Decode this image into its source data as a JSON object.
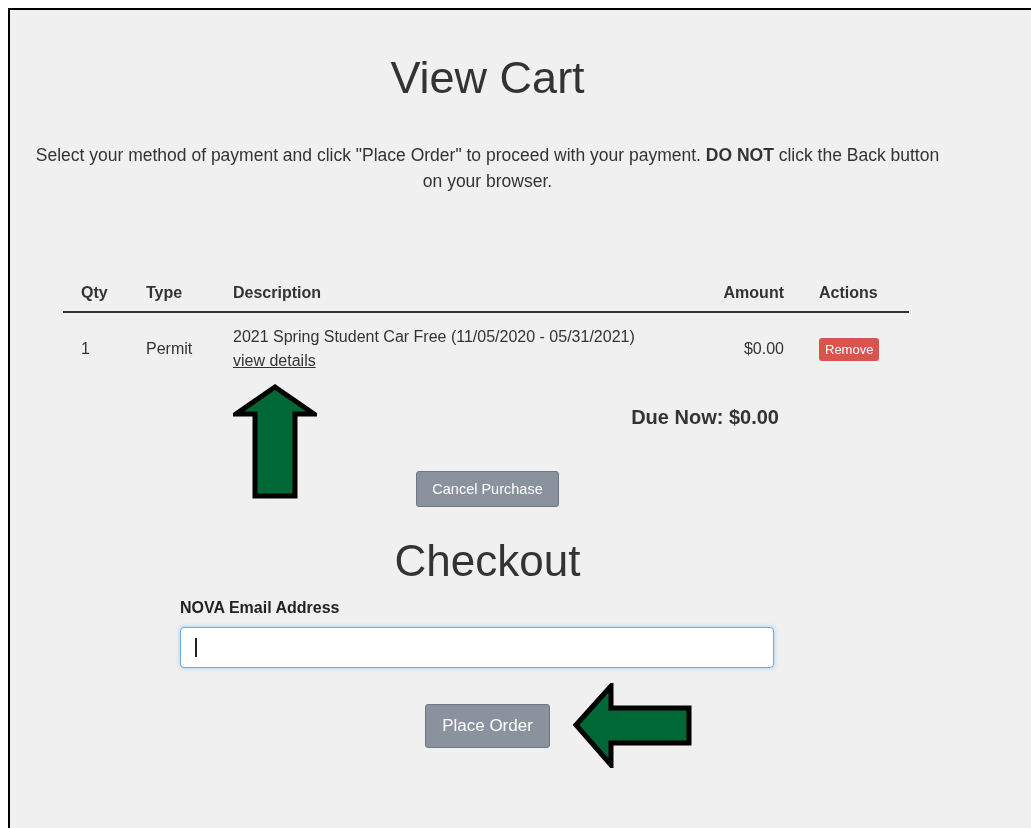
{
  "view_cart": {
    "title": "View Cart",
    "instructions": "Select your method of payment and click \"Place Order\" to proceed with your payment. **DO NOT** click the Back button on your browser.",
    "table": {
      "columns": [
        "Qty",
        "Type",
        "Description",
        "Amount",
        "Actions"
      ],
      "rows": [
        {
          "qty": "1",
          "type": "Permit",
          "description": "2021 Spring Student Car Free (11/05/2020 - 05/31/2021)",
          "details_link": "view details",
          "amount": "$0.00",
          "action": "Remove"
        }
      ]
    },
    "due_now": "Due Now: $0.00",
    "cancel_button": "Cancel Purchase"
  },
  "checkout": {
    "title": "Checkout",
    "email_label": "NOVA Email Address",
    "email_focused": true,
    "place_order_button": "Place Order"
  },
  "annotations": [
    {
      "kind": "up_arrow"
    },
    {
      "kind": "left_arrow"
    }
  ]
}
